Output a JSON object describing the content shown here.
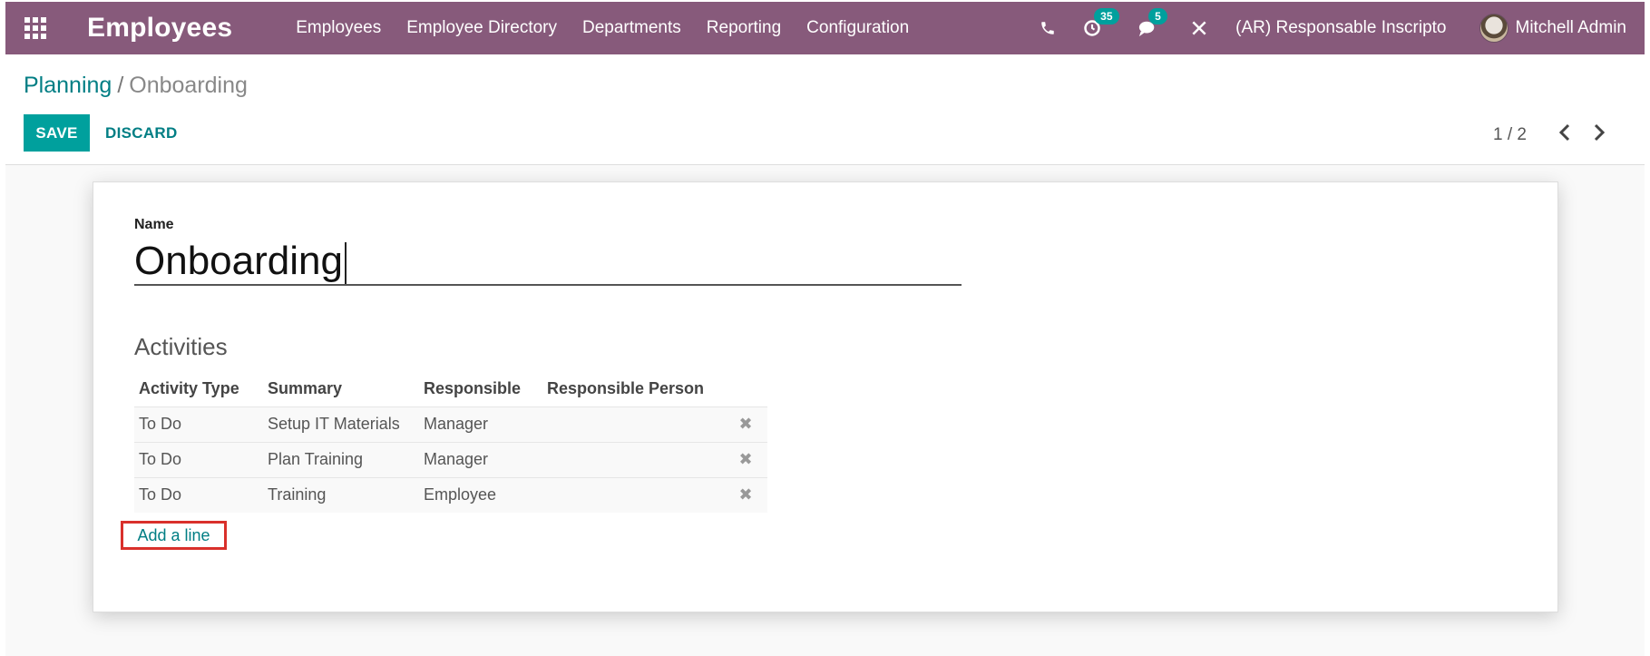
{
  "navbar": {
    "app_title": "Employees",
    "menu": [
      "Employees",
      "Employee Directory",
      "Departments",
      "Reporting",
      "Configuration"
    ],
    "activity_count": "35",
    "message_count": "5",
    "company": "(AR) Responsable Inscripto",
    "user_name": "Mitchell Admin",
    "accent_color": "#875a7b"
  },
  "breadcrumb": {
    "parent": "Planning",
    "separator": "/",
    "current": "Onboarding"
  },
  "buttons": {
    "save": "SAVE",
    "discard": "DISCARD"
  },
  "pager": {
    "value": "1 / 2"
  },
  "form": {
    "name_label": "Name",
    "name_value": "Onboarding",
    "activities_title": "Activities",
    "columns": [
      "Activity Type",
      "Summary",
      "Responsible",
      "Responsible Person"
    ],
    "rows": [
      {
        "type": "To Do",
        "summary": "Setup IT Materials",
        "responsible": "Manager",
        "person": ""
      },
      {
        "type": "To Do",
        "summary": "Plan Training",
        "responsible": "Manager",
        "person": ""
      },
      {
        "type": "To Do",
        "summary": "Training",
        "responsible": "Employee",
        "person": ""
      }
    ],
    "add_line": "Add a line"
  }
}
